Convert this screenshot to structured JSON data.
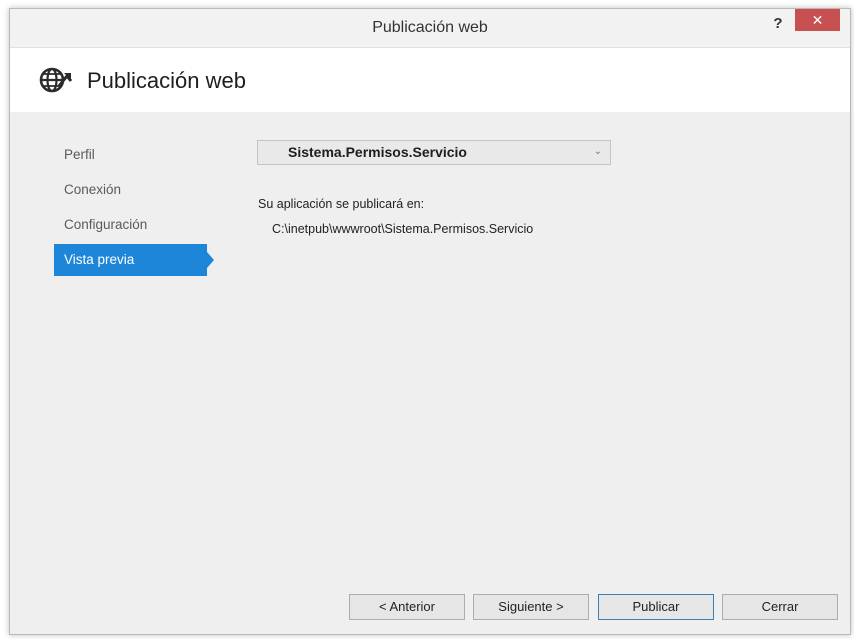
{
  "window": {
    "title": "Publicación web",
    "help_label": "?",
    "close_label": "✕"
  },
  "header": {
    "title": "Publicación web",
    "icon": "globe-publish-icon"
  },
  "sidebar": {
    "items": [
      {
        "label": "Perfil",
        "active": false
      },
      {
        "label": "Conexión",
        "active": false
      },
      {
        "label": "Configuración",
        "active": false
      },
      {
        "label": "Vista previa",
        "active": true
      }
    ],
    "active_color": "#1e86d8"
  },
  "main": {
    "profile_select": {
      "value": "Sistema.Permisos.Servicio",
      "icon": "chevron-down-icon"
    },
    "publish_label": "Su aplicación se publicará en:",
    "publish_path": "C:\\inetpub\\wwwroot\\Sistema.Permisos.Servicio"
  },
  "footer": {
    "back_label": "< Anterior",
    "next_label": "Siguiente >",
    "publish_label": "Publicar",
    "close_label": "Cerrar"
  },
  "colors": {
    "close_button": "#c75050",
    "accent": "#1e86d8",
    "primary_button_border": "#3c7fb1"
  }
}
